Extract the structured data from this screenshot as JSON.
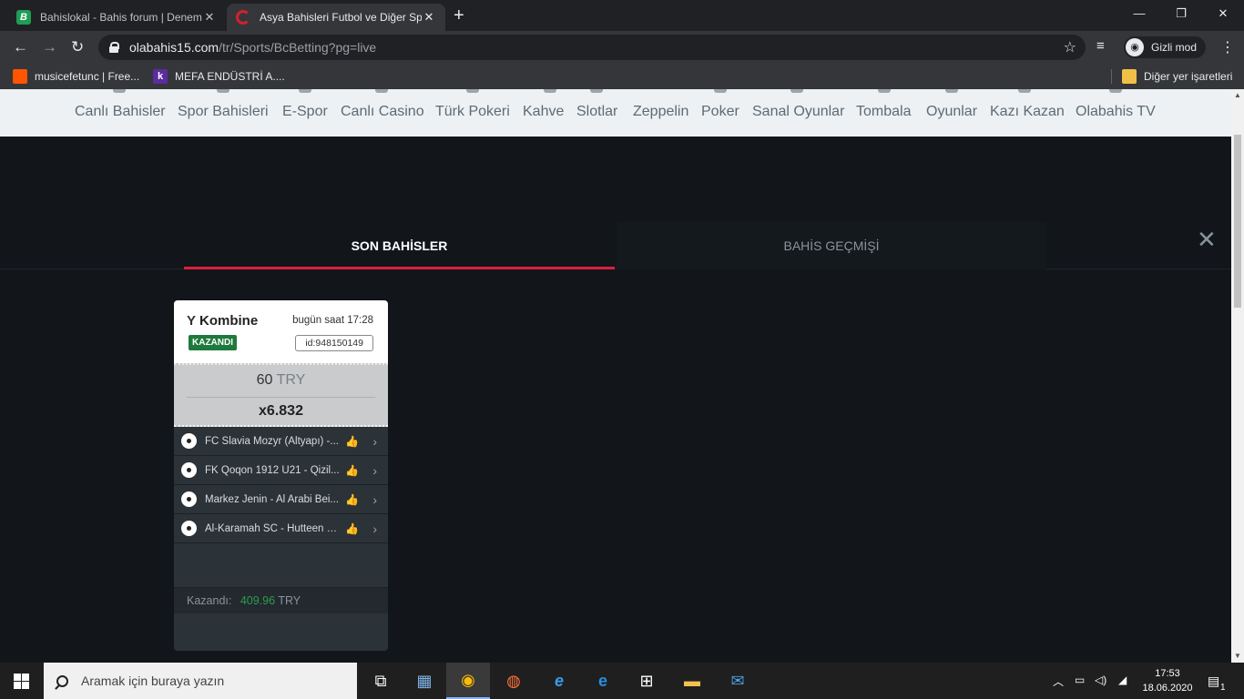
{
  "browser": {
    "tabs": [
      {
        "title": "Bahislokal - Bahis forum | Denem"
      },
      {
        "title": "Asya Bahisleri Futbol ve Diğer Sp"
      }
    ],
    "url_host": "olabahis15.com",
    "url_path": "/tr/Sports/BcBetting?pg=live",
    "incognito_label": "Gizli mod",
    "bookmarks": [
      {
        "label": "musicefetunc | Free..."
      },
      {
        "label": "MEFA ENDÜSTRİ A...."
      }
    ],
    "other_bookmarks": "Diğer yer işaretleri"
  },
  "site_nav": [
    "Canlı Bahisler",
    "Spor Bahisleri",
    "E-Spor",
    "Canlı Casino",
    "Türk Pokeri",
    "Kahve",
    "Slotlar",
    "Zeppelin",
    "Poker",
    "Sanal Oyunlar",
    "Tombala",
    "Oyunlar",
    "Kazı Kazan",
    "Olabahis TV"
  ],
  "bet_tabs": {
    "active": "SON BAHİSLER",
    "inactive": "BAHİS GEÇMİŞİ"
  },
  "bet_card": {
    "type": "Kombine",
    "time": "bugün saat 17:28",
    "status": "KAZANDI",
    "id": "id:948150149",
    "stake": "60",
    "currency": "TRY",
    "odds": "x6.832",
    "events": [
      "FC Slavia Mozyr (Altyapı) -...",
      "FK Qoqon 1912 U21 - Qizil...",
      "Markez Jenin - Al Arabi Bei...",
      "Al-Karamah SC - Hutteen SC"
    ],
    "win_label": "Kazandı:",
    "win_amount": "409.96",
    "win_currency": "TRY"
  },
  "colors": {
    "accent_red": "#e01e3c",
    "won_green": "#1e7a3c",
    "thumb_green": "#2fa84f"
  },
  "taskbar": {
    "search_placeholder": "Aramak için buraya yazın",
    "time": "17:53",
    "date": "18.06.2020",
    "notification_count": "1"
  }
}
